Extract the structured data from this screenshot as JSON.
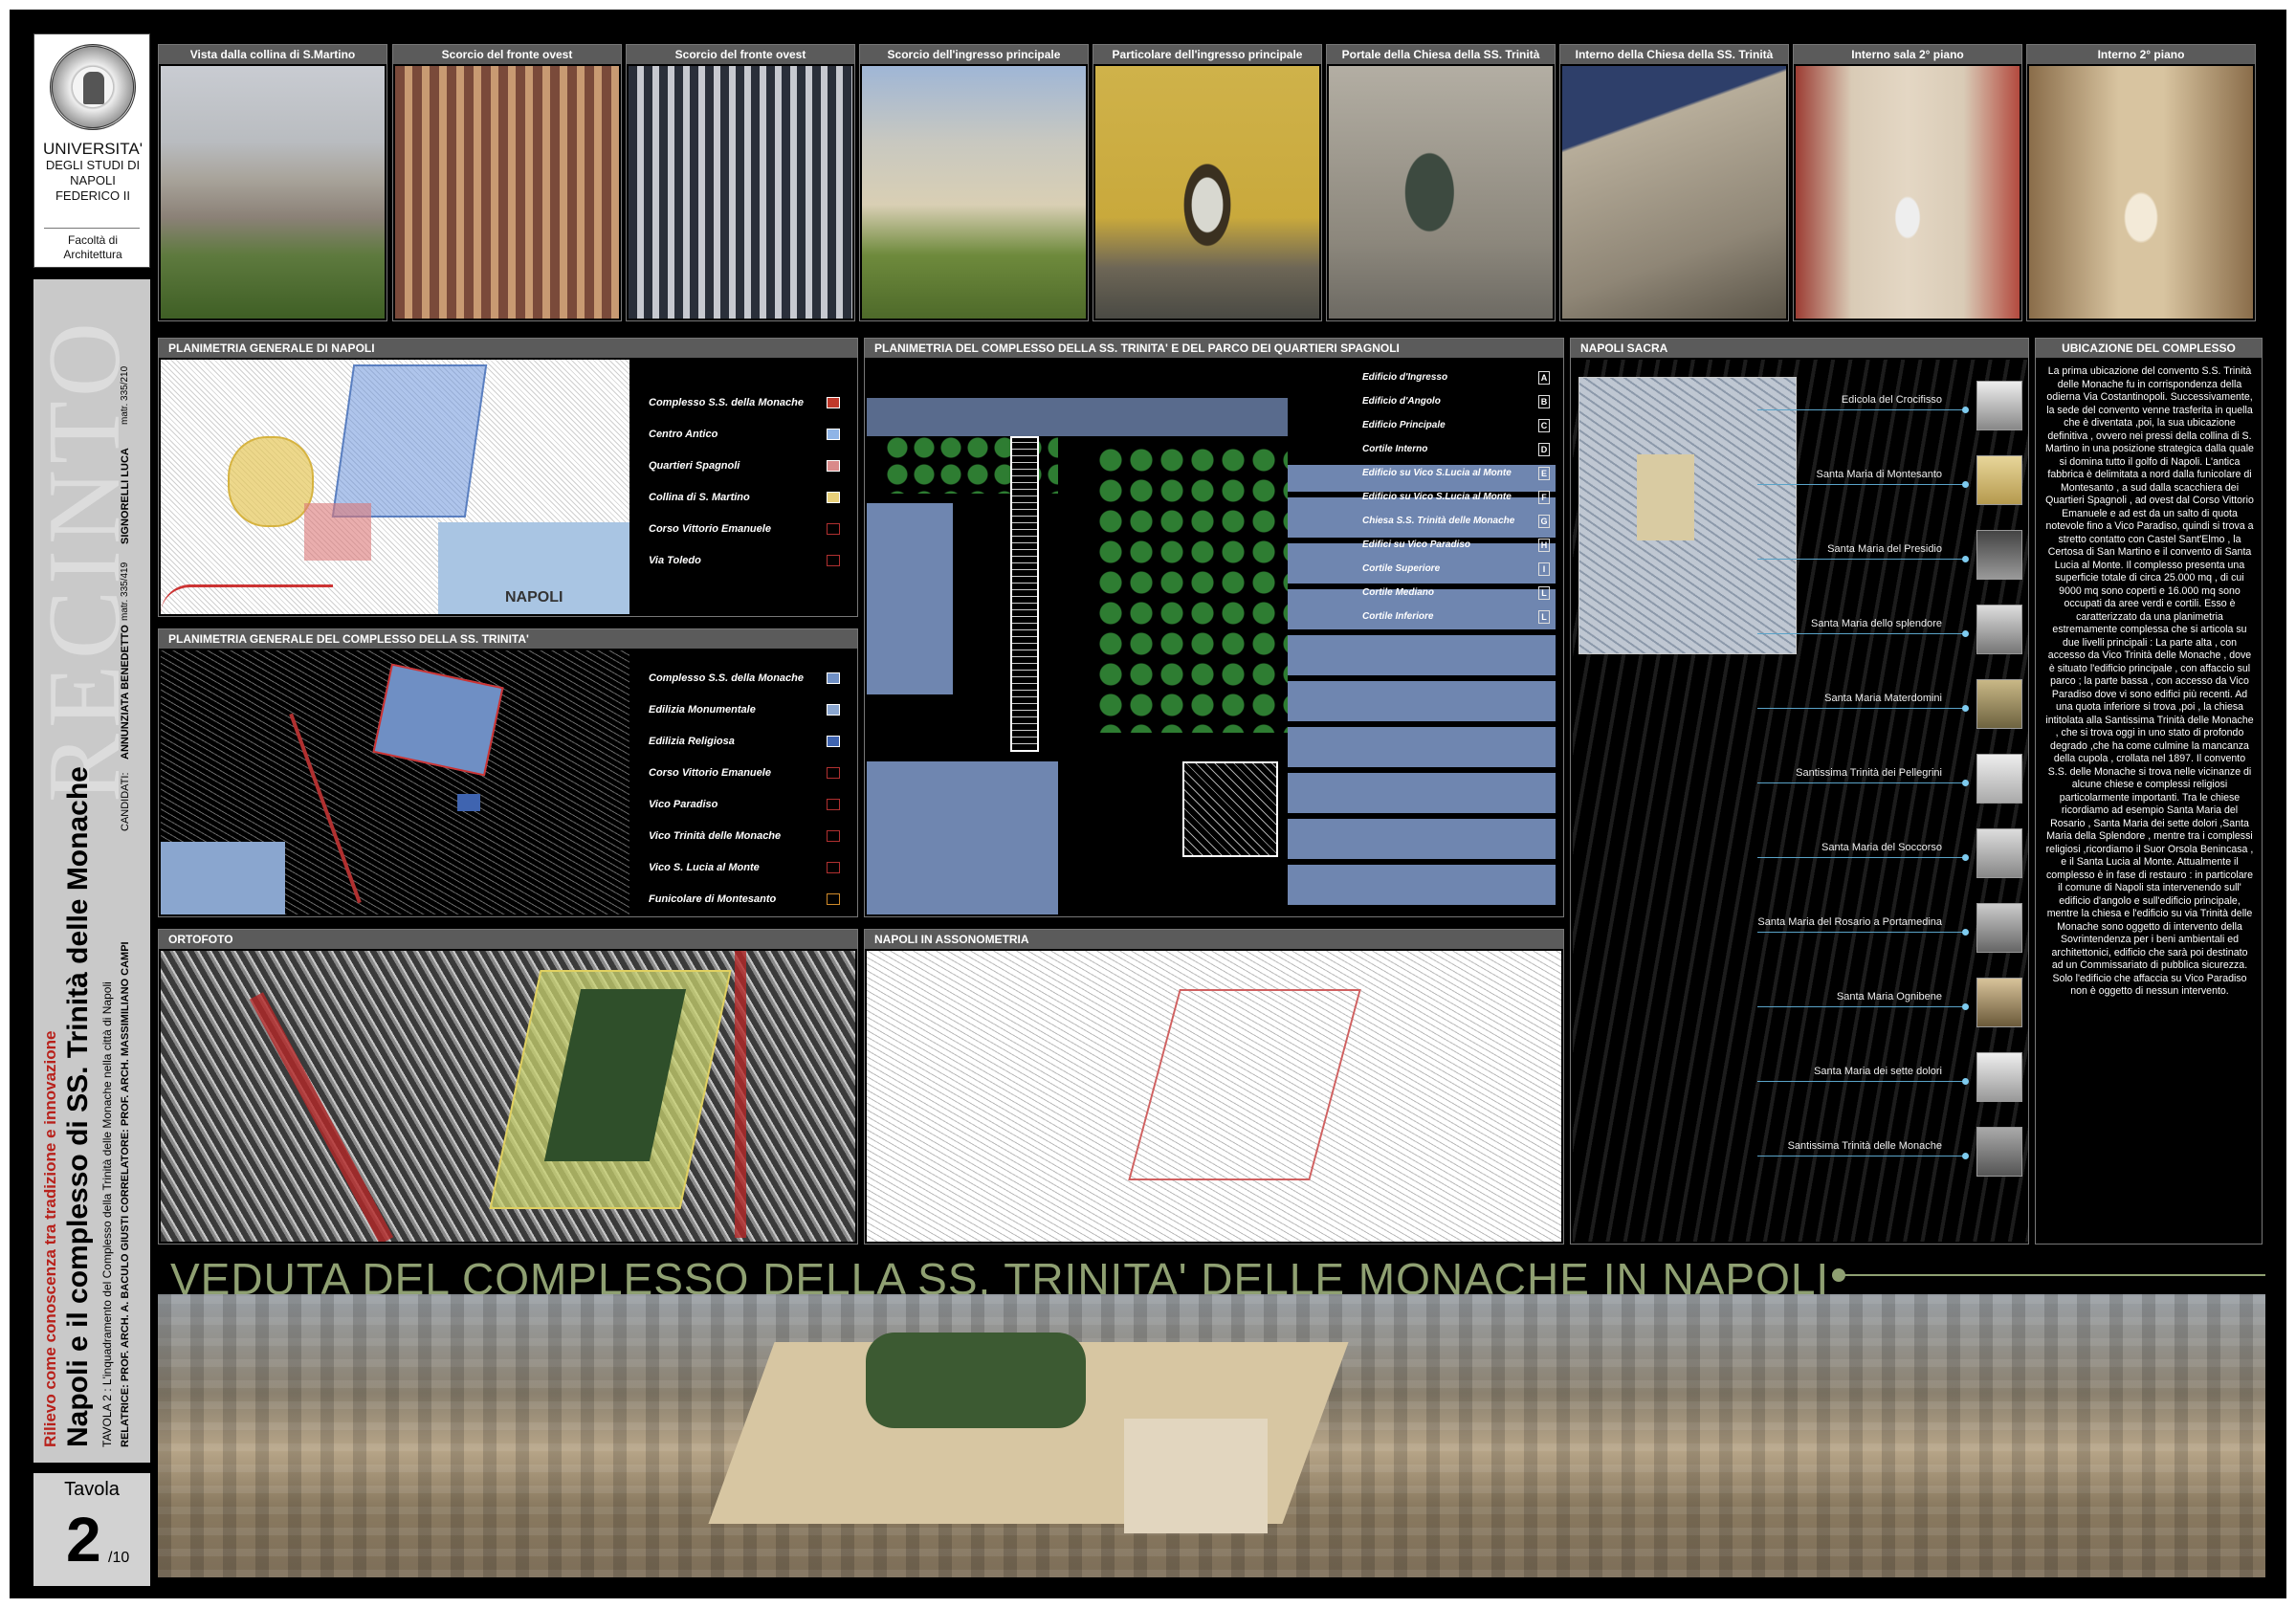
{
  "university": {
    "line1": "UNIVERSITA'",
    "line2": "DEGLI STUDI DI",
    "line3": "NAPOLI",
    "line4": "FEDERICO II",
    "faculty1": "Facoltà di",
    "faculty2": "Architettura"
  },
  "sidebar": {
    "ghost_word": "RECINTO",
    "subtitle": "Rilievo come conoscenza tra tradizione e innovazione",
    "title": "Napoli e il complesso di SS. Trinità delle Monache",
    "tavola_line": "TAVOLA 2 : L'inquadramento del Complesso della Trinità delle Monache nella città di Napoli",
    "credits": "RELATRICE: PROF. ARCH. A. BACULO GIUSTI CORRELATORE: PROF. ARCH. MASSIMILIANO CAMPI",
    "candidati_label": "CANDIDATI:",
    "candidato1": "ANNUNZIATA BENEDETTO",
    "matr1": "matr. 335/419",
    "candidato2": "SIGNORELLI LUCA",
    "matr2": "matr. 335/210"
  },
  "tavola": {
    "label": "Tavola",
    "number": "2",
    "of": "/10"
  },
  "photos": [
    {
      "caption": "Vista dalla collina di S.Martino"
    },
    {
      "caption": "Scorcio del fronte ovest"
    },
    {
      "caption": "Scorcio del fronte ovest"
    },
    {
      "caption": "Scorcio dell'ingresso principale"
    },
    {
      "caption": "Particolare dell'ingresso principale"
    },
    {
      "caption": "Portale della Chiesa della SS. Trinità"
    },
    {
      "caption": "Interno della Chiesa della SS. Trinità"
    },
    {
      "caption": "Interno sala 2° piano"
    },
    {
      "caption": "Interno 2° piano"
    }
  ],
  "plan_napoli": {
    "title": "PLANIMETRIA GENERALE DI NAPOLI",
    "map_label": "NAPOLI",
    "legend": [
      {
        "label": "Complesso S.S. della Monache",
        "color": "#c0392b"
      },
      {
        "label": "Centro Antico",
        "color": "#8fb4e6"
      },
      {
        "label": "Quartieri Spagnoli",
        "color": "#d98a8a"
      },
      {
        "label": "Collina di S. Martino",
        "color": "#e8d07a"
      },
      {
        "label": "Corso Vittorio Emanuele",
        "color": "#b03030"
      },
      {
        "label": "Via Toledo",
        "color": "#b03030"
      }
    ]
  },
  "plan_complesso": {
    "title": "PLANIMETRIA GENERALE DEL COMPLESSO DELLA SS. TRINITA'",
    "legend": [
      {
        "label": "Complesso S.S. della Monache",
        "color": "#6f8fc4"
      },
      {
        "label": "Edilizia Monumentale",
        "color": "#8aa6cf"
      },
      {
        "label": "Edilizia Religiosa",
        "color": "#3f64b0"
      },
      {
        "label": "Corso Vittorio Emanuele",
        "color": "#b03030"
      },
      {
        "label": "Vico Paradiso",
        "color": "#b03030"
      },
      {
        "label": "Vico Trinità delle Monache",
        "color": "#b03030"
      },
      {
        "label": "Vico S. Lucia al Monte",
        "color": "#b03030"
      },
      {
        "label": "Funicolare di Montesanto",
        "color": "#d08a2a"
      }
    ]
  },
  "plan_parco": {
    "title": "PLANIMETRIA DEL COMPLESSO DELLA SS. TRINITA' E DEL PARCO DEI QUARTIERI SPAGNOLI",
    "legend": [
      {
        "label": "Edificio d'Ingresso",
        "key": "A"
      },
      {
        "label": "Edificio d'Angolo",
        "key": "B"
      },
      {
        "label": "Edificio Principale",
        "key": "C"
      },
      {
        "label": "Cortile Interno",
        "key": "D"
      },
      {
        "label": "Edificio su Vico S.Lucia al Monte",
        "key": "E"
      },
      {
        "label": "Edificio su Vico S.Lucia al Monte",
        "key": "F"
      },
      {
        "label": "Chiesa S.S. Trinità delle Monache",
        "key": "G"
      },
      {
        "label": "Edifici su Vico Paradiso",
        "key": "H"
      },
      {
        "label": "Cortile Superiore",
        "key": "I"
      },
      {
        "label": "Cortile Mediano",
        "key": "L"
      },
      {
        "label": "Cortile Inferiore",
        "key": "L"
      }
    ]
  },
  "napoli_sacra": {
    "title": "NAPOLI SACRA",
    "churches": [
      "Edicola del Crocifisso",
      "Santa Maria di Montesanto",
      "Santa Maria del Presidio",
      "Santa Maria dello splendore",
      "Santa Maria Materdomini",
      "Santissima Trinità dei Pellegrini",
      "Santa Maria del Soccorso",
      "Santa Maria del Rosario a Portamedina",
      "Santa Maria Ognibene",
      "Santa Maria dei sette dolori",
      "Santissima Trinità delle Monache"
    ]
  },
  "ubicazione": {
    "title": "UBICAZIONE DEL COMPLESSO",
    "text": "La prima ubicazione del convento S.S. Trinità delle Monache fu in corrispondenza della odierna Via Costantinopoli. Successivamente, la sede del convento venne trasferita in quella che è diventata ,poi, la sua ubicazione definitiva , ovvero nei pressi della collina di S. Martino in una posizione strategica dalla quale si domina tutto il golfo di Napoli. L'antica fabbrica è delimitata a nord dalla funicolare di Montesanto , a sud dalla scacchiera dei Quartieri Spagnoli , ad ovest dal Corso Vittorio Emanuele e ad est da un salto di quota notevole fino a Vico Paradiso, quindi si trova a stretto contatto con Castel Sant'Elmo , la Certosa di San Martino e il convento di Santa Lucia al Monte. Il complesso presenta una superficie totale di circa 25.000 mq , di cui 9000 mq sono coperti e 16.000 mq sono occupati da aree verdi e cortili. Esso è caratterizzato da una planimetria estremamente complessa che si articola su due livelli principali : La parte alta , con accesso da Vico Trinità delle Monache , dove è situato l'edificio principale , con affaccio sul parco ; la parte bassa , con accesso da Vico Paradiso dove vi sono edifici più recenti. Ad una quota inferiore si trova ,poi , la chiesa intitolata alla Santissima Trinità delle Monache , che si trova oggi in uno stato di profondo degrado ,che ha come culmine la mancanza della cupola , crollata nel 1897. Il convento S.S. delle Monache si trova nelle vicinanze di alcune chiese e complessi religiosi particolarmente importanti. Tra le chiese ricordiamo ad esempio Santa Maria del Rosario , Santa Maria dei sette dolori ,Santa Maria della Splendore , mentre tra i complessi religiosi ,ricordiamo il Suor Orsola Benincasa , e il Santa Lucia al Monte. Attualmente il complesso è in fase di restauro : in particolare il comune di Napoli sta intervenendo sull' edificio d'angolo e sull'edificio principale, mentre la chiesa e l'edificio su via Trinità delle Monache sono oggetto di intervento della Sovrintendenza per i beni ambientali ed architettonici, edificio che sarà poi destinato ad un Commissariato di pubblica sicurezza. Solo l'edificio che affaccia su Vico Paradiso non è oggetto di nessun intervento."
  },
  "ortofoto": {
    "title": "ORTOFOTO"
  },
  "assonometria": {
    "title": "NAPOLI IN ASSONOMETRIA"
  },
  "veduta": {
    "title": "VEDUTA DEL COMPLESSO DELLA SS. TRINITA' DELLE MONACHE IN NAPOLI"
  }
}
